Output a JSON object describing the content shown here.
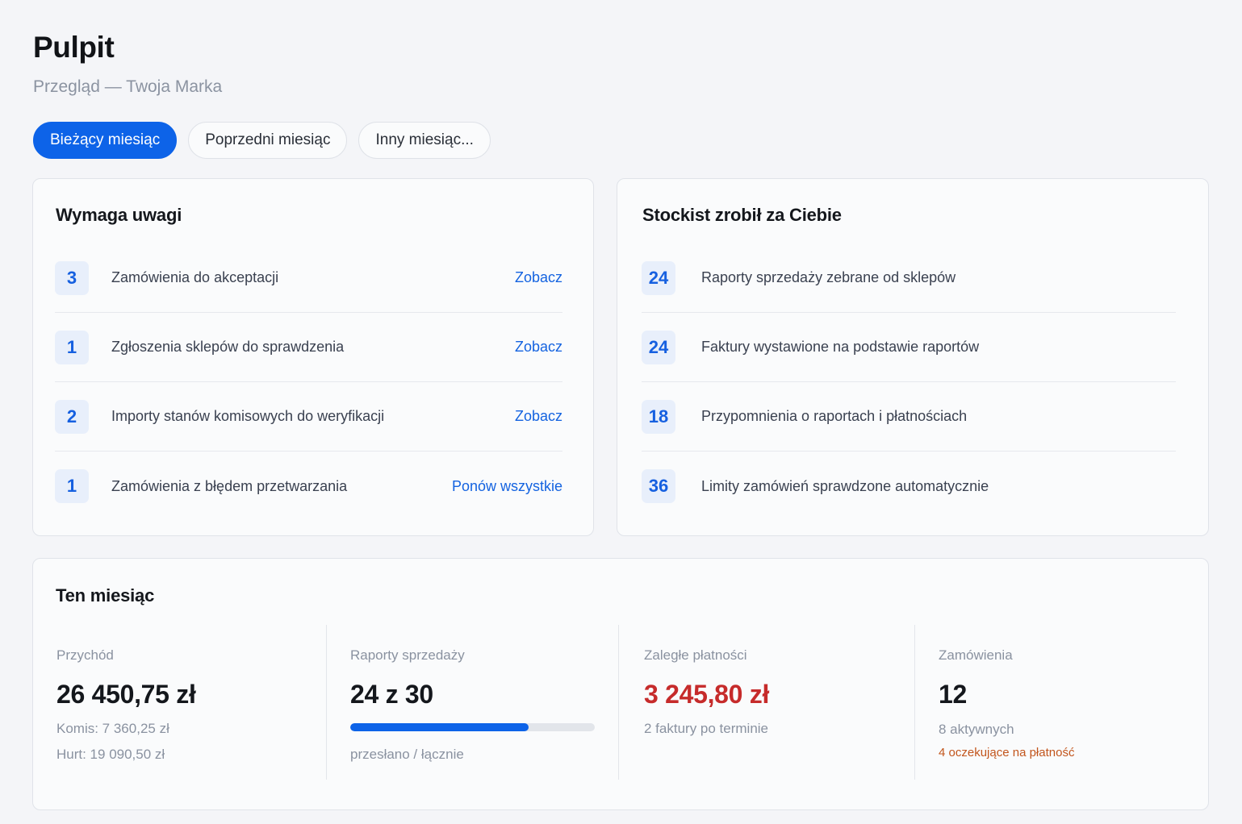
{
  "header": {
    "title": "Pulpit",
    "subtitle": "Przegląd — Twoja Marka"
  },
  "tabs": [
    {
      "label": "Bieżący miesiąc",
      "active": true
    },
    {
      "label": "Poprzedni miesiąc",
      "active": false
    },
    {
      "label": "Inny miesiąc...",
      "active": false
    }
  ],
  "attention": {
    "title": "Wymaga uwagi",
    "items": [
      {
        "count": "3",
        "label": "Zamówienia do akceptacji",
        "action": "Zobacz"
      },
      {
        "count": "1",
        "label": "Zgłoszenia sklepów do sprawdzenia",
        "action": "Zobacz"
      },
      {
        "count": "2",
        "label": "Importy stanów komisowych do weryfikacji",
        "action": "Zobacz"
      },
      {
        "count": "1",
        "label": "Zamówienia z błędem przetwarzania",
        "action": "Ponów wszystkie"
      }
    ]
  },
  "automation": {
    "title": "Stockist zrobił za Ciebie",
    "items": [
      {
        "count": "24",
        "label": "Raporty sprzedaży zebrane od sklepów"
      },
      {
        "count": "24",
        "label": "Faktury wystawione na podstawie raportów"
      },
      {
        "count": "18",
        "label": "Przypomnienia o raportach i płatnościach"
      },
      {
        "count": "36",
        "label": "Limity zamówień sprawdzone automatycznie"
      }
    ]
  },
  "month": {
    "title": "Ten miesiąc",
    "revenue": {
      "label": "Przychód",
      "value": "26 450,75 zł",
      "consignment": "Komis: 7 360,25 zł",
      "wholesale": "Hurt: 19 090,50 zł"
    },
    "reports": {
      "label": "Raporty sprzedaży",
      "value": "24 z 30",
      "progress_fraction": 0.73,
      "caption": "przesłano / łącznie"
    },
    "overdue": {
      "label": "Zaległe płatności",
      "value": "3 245,80 zł",
      "caption": "2 faktury po terminie"
    },
    "orders": {
      "label": "Zamówienia",
      "value": "12",
      "active": "8 aktywnych",
      "pending": "4 oczekujące na płatność"
    }
  },
  "colors": {
    "accent": "#0d63e8",
    "danger": "#c62b2b",
    "warning": "#c2551c"
  }
}
